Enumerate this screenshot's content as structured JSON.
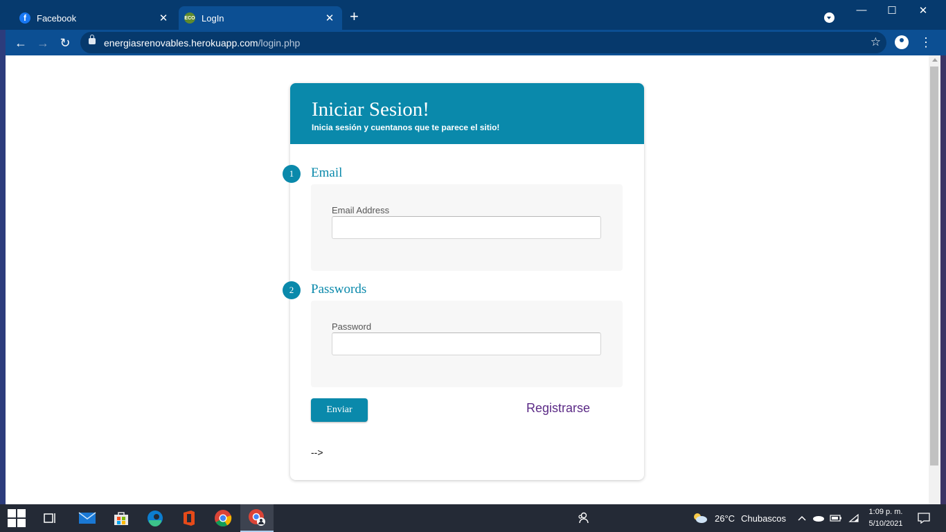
{
  "browser": {
    "tabs": [
      {
        "title": "Facebook",
        "favicon": "facebook-icon",
        "active": false
      },
      {
        "title": "LogIn",
        "favicon": "eco-leaf-icon",
        "active": true
      }
    ],
    "new_tab": "+",
    "url_domain": "energiasrenovables.herokuapp.com",
    "url_path": "/login.php",
    "window_controls": {
      "minimize": "—",
      "maximize": "☐",
      "close": "✕"
    }
  },
  "login_card": {
    "title": "Iniciar Sesion!",
    "subtitle": "Inicia sesión y cuentanos que te parece el sitio!",
    "steps": [
      {
        "number": "1",
        "label": "Email",
        "field_label": "Email Address",
        "value": ""
      },
      {
        "number": "2",
        "label": "Passwords",
        "field_label": "Password",
        "value": ""
      }
    ],
    "submit_label": "Enviar",
    "register_label": "Registrarse",
    "trailing_text": "-->"
  },
  "taskbar": {
    "weather": {
      "temperature": "26°C",
      "condition": "Chubascos"
    },
    "clock": {
      "time": "1:09 p. m.",
      "date": "5/10/2021"
    }
  },
  "colors": {
    "accent": "#0a89ab",
    "link": "#5b2a86",
    "browser_frame": "#063a6e",
    "browser_toolbar": "#0c4f93"
  }
}
